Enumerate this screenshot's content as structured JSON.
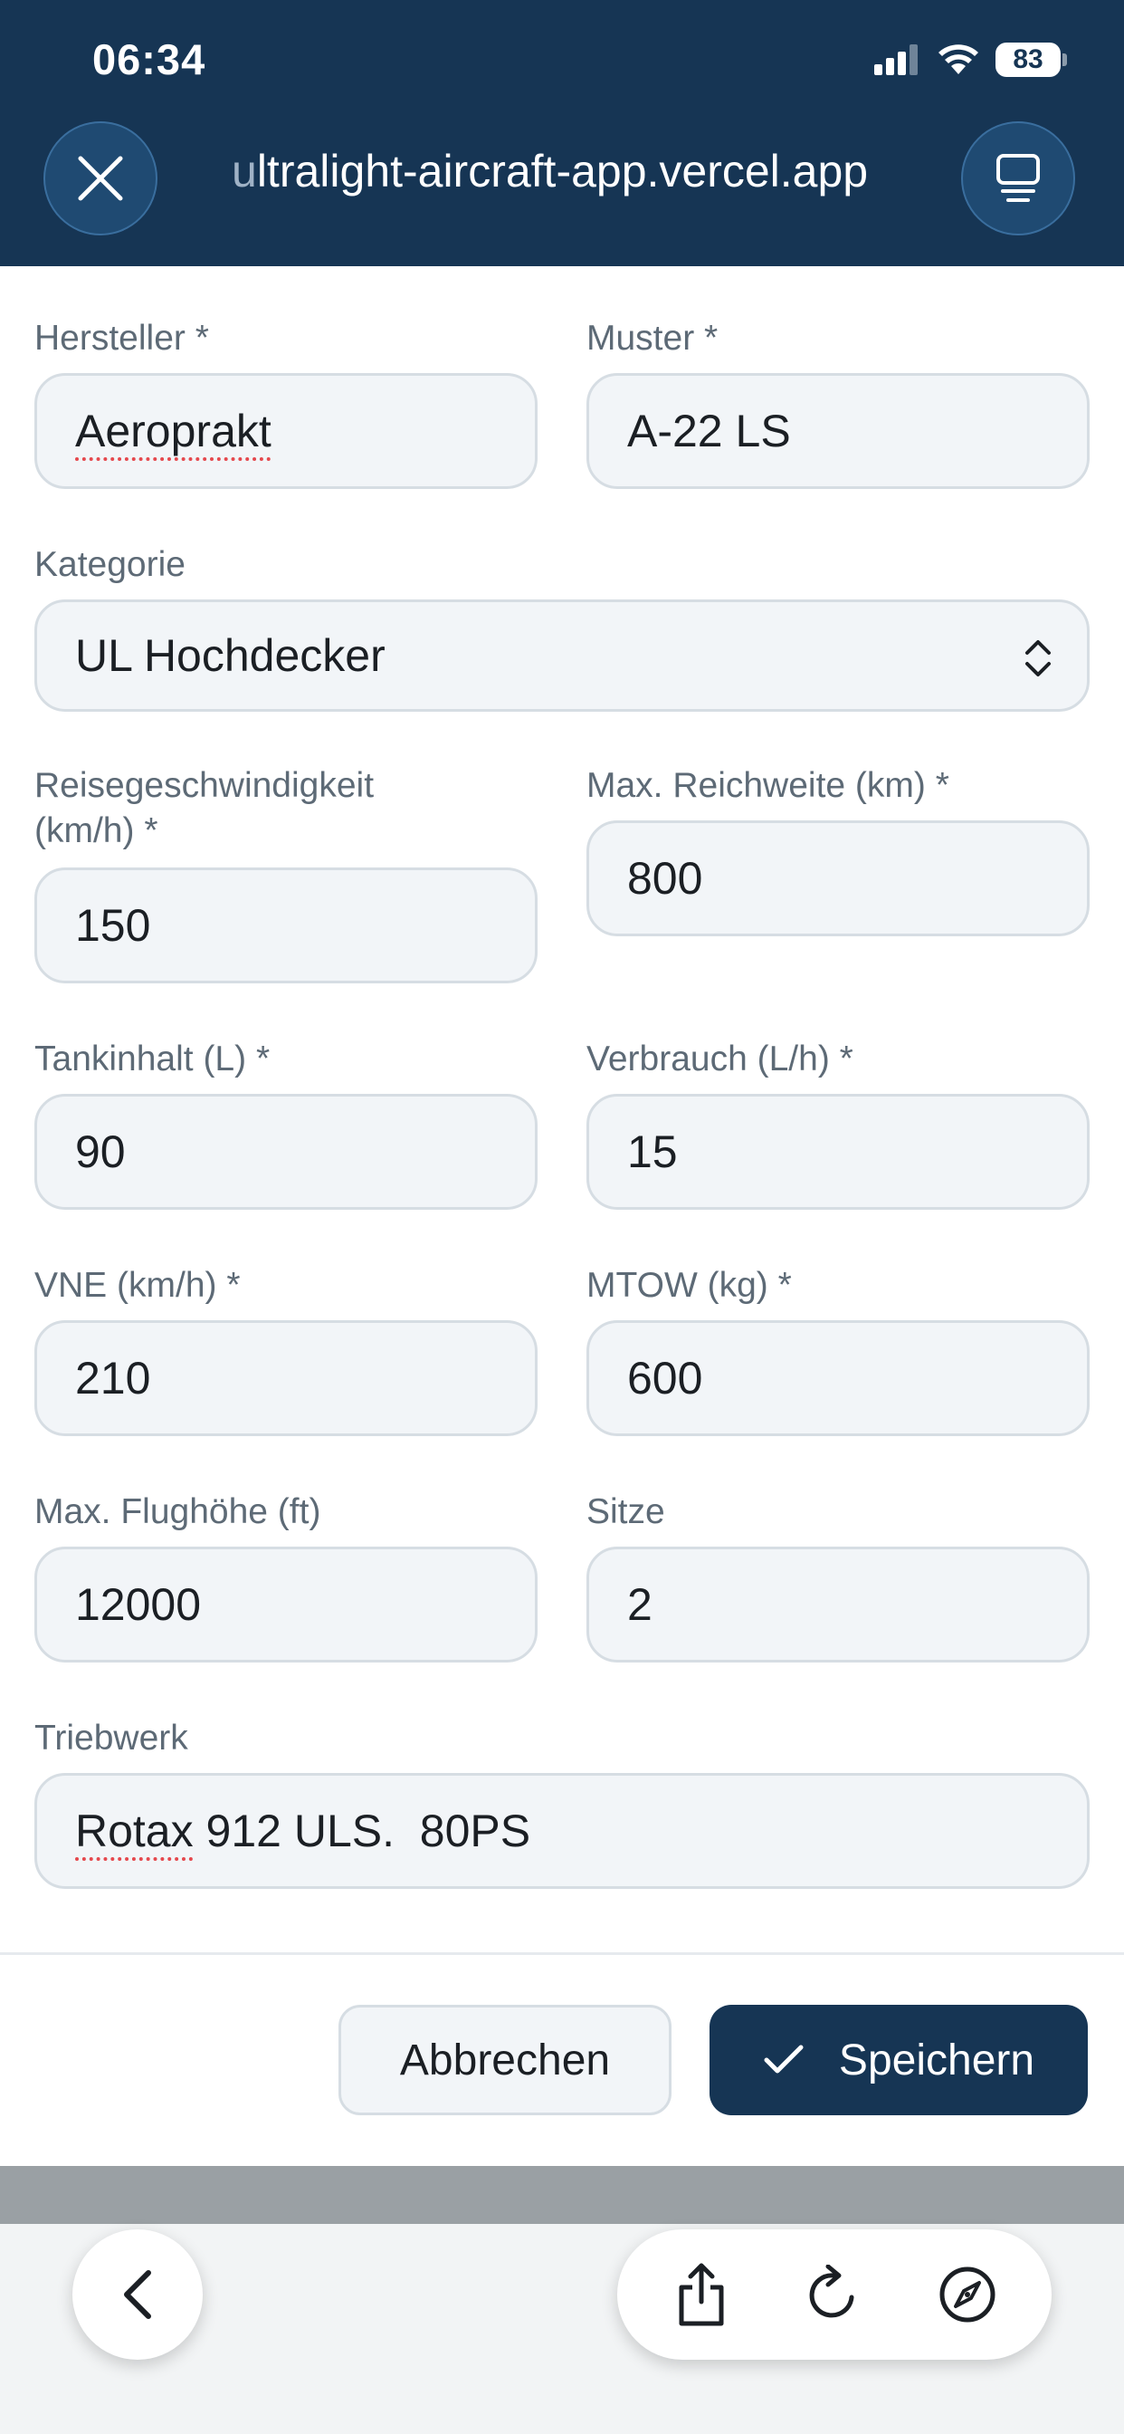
{
  "status_bar": {
    "time": "06:34",
    "battery": "83"
  },
  "browser": {
    "url_first_char": "u",
    "url_rest": "ltralight-aircraft-app.vercel.app"
  },
  "form": {
    "manufacturer": {
      "label": "Hersteller *",
      "value": "Aeroprakt"
    },
    "model": {
      "label": "Muster *",
      "value": "A-22 LS"
    },
    "category": {
      "label": "Kategorie",
      "value": "UL Hochdecker"
    },
    "cruise_speed": {
      "label_line1": "Reisegeschwindigkeit",
      "label_line2": "(km/h) *",
      "value": "150"
    },
    "max_range": {
      "label": "Max. Reichweite (km) *",
      "value": "800"
    },
    "tank": {
      "label": "Tankinhalt (L) *",
      "value": "90"
    },
    "consumption": {
      "label": "Verbrauch (L/h) *",
      "value": "15"
    },
    "vne": {
      "label": "VNE (km/h) *",
      "value": "210"
    },
    "mtow": {
      "label": "MTOW (kg) *",
      "value": "600"
    },
    "max_altitude": {
      "label": "Max. Flughöhe (ft)",
      "value": "12000"
    },
    "seats": {
      "label": "Sitze",
      "value": "2"
    },
    "engine": {
      "label": "Triebwerk",
      "value_part1": "Rotax",
      "value_part2": " 912 ULS.  80PS"
    }
  },
  "actions": {
    "cancel_label": "Abbrechen",
    "save_label": "Speichern"
  },
  "icons": {
    "close": "close-icon",
    "tabs": "tabs-icon",
    "back": "chevron-left-icon",
    "share": "share-icon",
    "reload": "reload-icon",
    "compass": "compass-icon",
    "check": "check-icon",
    "select": "chevron-up-down-icon"
  },
  "colors": {
    "primary": "#163554",
    "field_bg": "#f2f5f8",
    "field_border": "#d6dde3",
    "label": "#5d6a76"
  }
}
